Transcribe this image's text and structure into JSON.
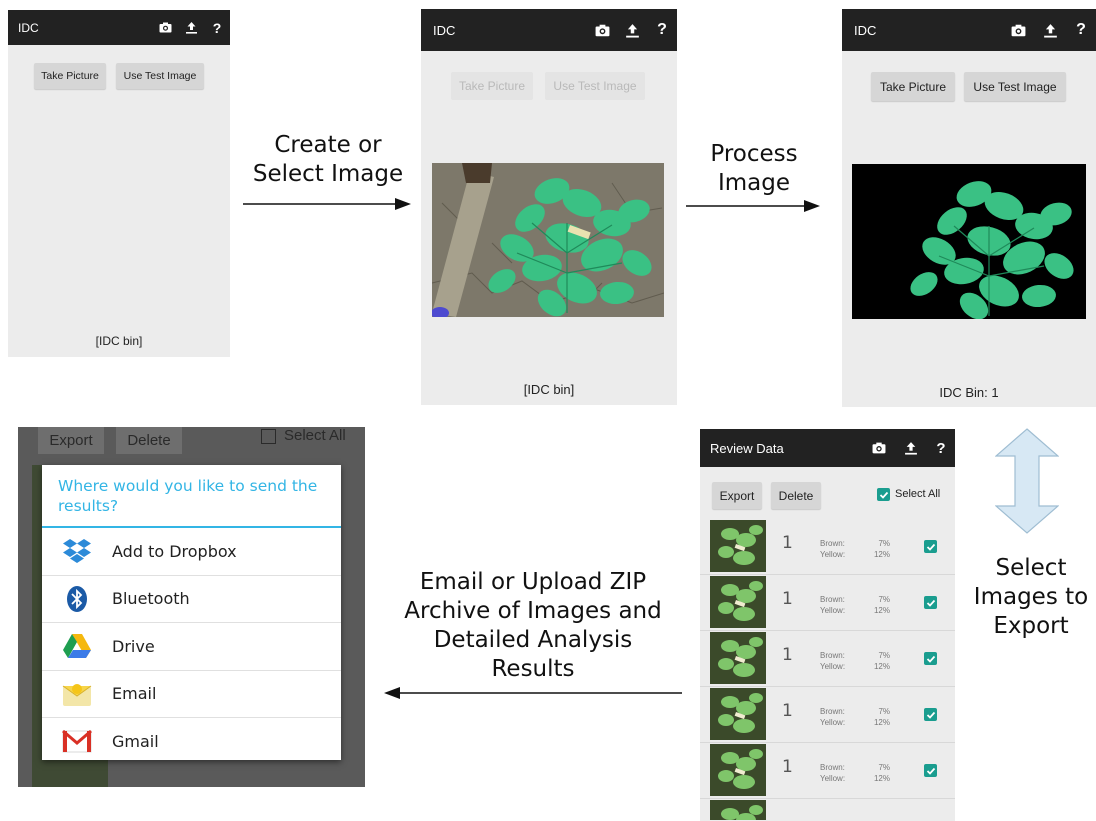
{
  "screen1": {
    "app_title": "IDC",
    "take_picture": "Take Picture",
    "use_test_image": "Use Test Image",
    "bin_label": "[IDC bin]"
  },
  "screen2": {
    "app_title": "IDC",
    "take_picture": "Take Picture",
    "use_test_image": "Use Test Image",
    "bin_label": "[IDC bin]"
  },
  "screen3": {
    "app_title": "IDC",
    "take_picture": "Take Picture",
    "use_test_image": "Use Test Image",
    "bin_label": "IDC Bin: 1"
  },
  "captions": {
    "create_line1": "Create or",
    "create_line2": "Select Image",
    "process_line1": "Process",
    "process_line2": "Image",
    "select_line1": "Select",
    "select_line2": "Images to",
    "select_line3": "Export",
    "email_line1": "Email or Upload ZIP",
    "email_line2": "Archive of Images and",
    "email_line3": "Detailed Analysis",
    "email_line4": "Results"
  },
  "share_screen": {
    "export_label": "Export",
    "delete_label": "Delete",
    "select_all_label": "Select All",
    "dialog_title": "Where would you like to send the results?",
    "options": [
      {
        "label": "Add to Dropbox",
        "icon": "dropbox-icon"
      },
      {
        "label": "Bluetooth",
        "icon": "bluetooth-icon"
      },
      {
        "label": "Drive",
        "icon": "drive-icon"
      },
      {
        "label": "Email",
        "icon": "email-icon"
      },
      {
        "label": "Gmail",
        "icon": "gmail-icon"
      }
    ]
  },
  "review_screen": {
    "title": "Review Data",
    "export_label": "Export",
    "delete_label": "Delete",
    "select_all_label": "Select All",
    "rows": [
      {
        "bin": "1",
        "brown_label": "Brown:",
        "yellow_label": "Yellow:",
        "brown": "7%",
        "yellow": "12%"
      },
      {
        "bin": "1",
        "brown_label": "Brown:",
        "yellow_label": "Yellow:",
        "brown": "7%",
        "yellow": "12%"
      },
      {
        "bin": "1",
        "brown_label": "Brown:",
        "yellow_label": "Yellow:",
        "brown": "7%",
        "yellow": "12%"
      },
      {
        "bin": "1",
        "brown_label": "Brown:",
        "yellow_label": "Yellow:",
        "brown": "7%",
        "yellow": "12%"
      },
      {
        "bin": "1",
        "brown_label": "Brown:",
        "yellow_label": "Yellow:",
        "brown": "7%",
        "yellow": "12%"
      }
    ]
  },
  "icons": {
    "camera": "camera-icon",
    "upload": "upload-icon",
    "help": "help-icon"
  },
  "colors": {
    "action_bar": "#222222",
    "accent": "#33b5e5",
    "checkbox": "#1a9d8f",
    "leaf": "#2fbf7c",
    "screen_bg": "#ececec"
  }
}
